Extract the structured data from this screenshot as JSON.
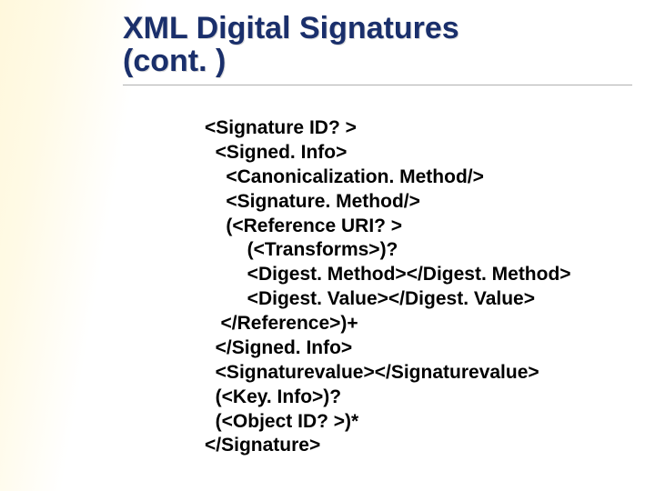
{
  "title": {
    "line1": "XML Digital Signatures",
    "line2": "(cont. )"
  },
  "lines": [
    "<Signature ID? >",
    "  <Signed. Info>",
    "    <Canonicalization. Method/>",
    "    <Signature. Method/>",
    "    (<Reference URI? >",
    "        (<Transforms>)?",
    "        <Digest. Method></Digest. Method>",
    "        <Digest. Value></Digest. Value>",
    "   </Reference>)+",
    "  </Signed. Info>",
    "  <Signaturevalue></Signaturevalue>",
    "  (<Key. Info>)?",
    "  (<Object ID? >)*",
    "</Signature>"
  ]
}
